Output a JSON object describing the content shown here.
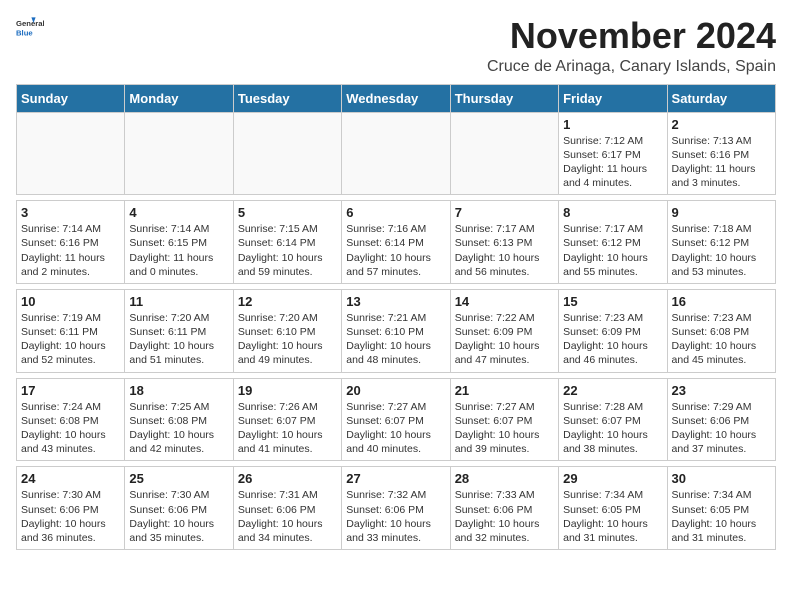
{
  "header": {
    "logo_general": "General",
    "logo_blue": "Blue",
    "month_title": "November 2024",
    "subtitle": "Cruce de Arinaga, Canary Islands, Spain"
  },
  "days_of_week": [
    "Sunday",
    "Monday",
    "Tuesday",
    "Wednesday",
    "Thursday",
    "Friday",
    "Saturday"
  ],
  "weeks": [
    [
      {
        "day": "",
        "info": ""
      },
      {
        "day": "",
        "info": ""
      },
      {
        "day": "",
        "info": ""
      },
      {
        "day": "",
        "info": ""
      },
      {
        "day": "",
        "info": ""
      },
      {
        "day": "1",
        "info": "Sunrise: 7:12 AM\nSunset: 6:17 PM\nDaylight: 11 hours\nand 4 minutes."
      },
      {
        "day": "2",
        "info": "Sunrise: 7:13 AM\nSunset: 6:16 PM\nDaylight: 11 hours\nand 3 minutes."
      }
    ],
    [
      {
        "day": "3",
        "info": "Sunrise: 7:14 AM\nSunset: 6:16 PM\nDaylight: 11 hours\nand 2 minutes."
      },
      {
        "day": "4",
        "info": "Sunrise: 7:14 AM\nSunset: 6:15 PM\nDaylight: 11 hours\nand 0 minutes."
      },
      {
        "day": "5",
        "info": "Sunrise: 7:15 AM\nSunset: 6:14 PM\nDaylight: 10 hours\nand 59 minutes."
      },
      {
        "day": "6",
        "info": "Sunrise: 7:16 AM\nSunset: 6:14 PM\nDaylight: 10 hours\nand 57 minutes."
      },
      {
        "day": "7",
        "info": "Sunrise: 7:17 AM\nSunset: 6:13 PM\nDaylight: 10 hours\nand 56 minutes."
      },
      {
        "day": "8",
        "info": "Sunrise: 7:17 AM\nSunset: 6:12 PM\nDaylight: 10 hours\nand 55 minutes."
      },
      {
        "day": "9",
        "info": "Sunrise: 7:18 AM\nSunset: 6:12 PM\nDaylight: 10 hours\nand 53 minutes."
      }
    ],
    [
      {
        "day": "10",
        "info": "Sunrise: 7:19 AM\nSunset: 6:11 PM\nDaylight: 10 hours\nand 52 minutes."
      },
      {
        "day": "11",
        "info": "Sunrise: 7:20 AM\nSunset: 6:11 PM\nDaylight: 10 hours\nand 51 minutes."
      },
      {
        "day": "12",
        "info": "Sunrise: 7:20 AM\nSunset: 6:10 PM\nDaylight: 10 hours\nand 49 minutes."
      },
      {
        "day": "13",
        "info": "Sunrise: 7:21 AM\nSunset: 6:10 PM\nDaylight: 10 hours\nand 48 minutes."
      },
      {
        "day": "14",
        "info": "Sunrise: 7:22 AM\nSunset: 6:09 PM\nDaylight: 10 hours\nand 47 minutes."
      },
      {
        "day": "15",
        "info": "Sunrise: 7:23 AM\nSunset: 6:09 PM\nDaylight: 10 hours\nand 46 minutes."
      },
      {
        "day": "16",
        "info": "Sunrise: 7:23 AM\nSunset: 6:08 PM\nDaylight: 10 hours\nand 45 minutes."
      }
    ],
    [
      {
        "day": "17",
        "info": "Sunrise: 7:24 AM\nSunset: 6:08 PM\nDaylight: 10 hours\nand 43 minutes."
      },
      {
        "day": "18",
        "info": "Sunrise: 7:25 AM\nSunset: 6:08 PM\nDaylight: 10 hours\nand 42 minutes."
      },
      {
        "day": "19",
        "info": "Sunrise: 7:26 AM\nSunset: 6:07 PM\nDaylight: 10 hours\nand 41 minutes."
      },
      {
        "day": "20",
        "info": "Sunrise: 7:27 AM\nSunset: 6:07 PM\nDaylight: 10 hours\nand 40 minutes."
      },
      {
        "day": "21",
        "info": "Sunrise: 7:27 AM\nSunset: 6:07 PM\nDaylight: 10 hours\nand 39 minutes."
      },
      {
        "day": "22",
        "info": "Sunrise: 7:28 AM\nSunset: 6:07 PM\nDaylight: 10 hours\nand 38 minutes."
      },
      {
        "day": "23",
        "info": "Sunrise: 7:29 AM\nSunset: 6:06 PM\nDaylight: 10 hours\nand 37 minutes."
      }
    ],
    [
      {
        "day": "24",
        "info": "Sunrise: 7:30 AM\nSunset: 6:06 PM\nDaylight: 10 hours\nand 36 minutes."
      },
      {
        "day": "25",
        "info": "Sunrise: 7:30 AM\nSunset: 6:06 PM\nDaylight: 10 hours\nand 35 minutes."
      },
      {
        "day": "26",
        "info": "Sunrise: 7:31 AM\nSunset: 6:06 PM\nDaylight: 10 hours\nand 34 minutes."
      },
      {
        "day": "27",
        "info": "Sunrise: 7:32 AM\nSunset: 6:06 PM\nDaylight: 10 hours\nand 33 minutes."
      },
      {
        "day": "28",
        "info": "Sunrise: 7:33 AM\nSunset: 6:06 PM\nDaylight: 10 hours\nand 32 minutes."
      },
      {
        "day": "29",
        "info": "Sunrise: 7:34 AM\nSunset: 6:05 PM\nDaylight: 10 hours\nand 31 minutes."
      },
      {
        "day": "30",
        "info": "Sunrise: 7:34 AM\nSunset: 6:05 PM\nDaylight: 10 hours\nand 31 minutes."
      }
    ]
  ]
}
